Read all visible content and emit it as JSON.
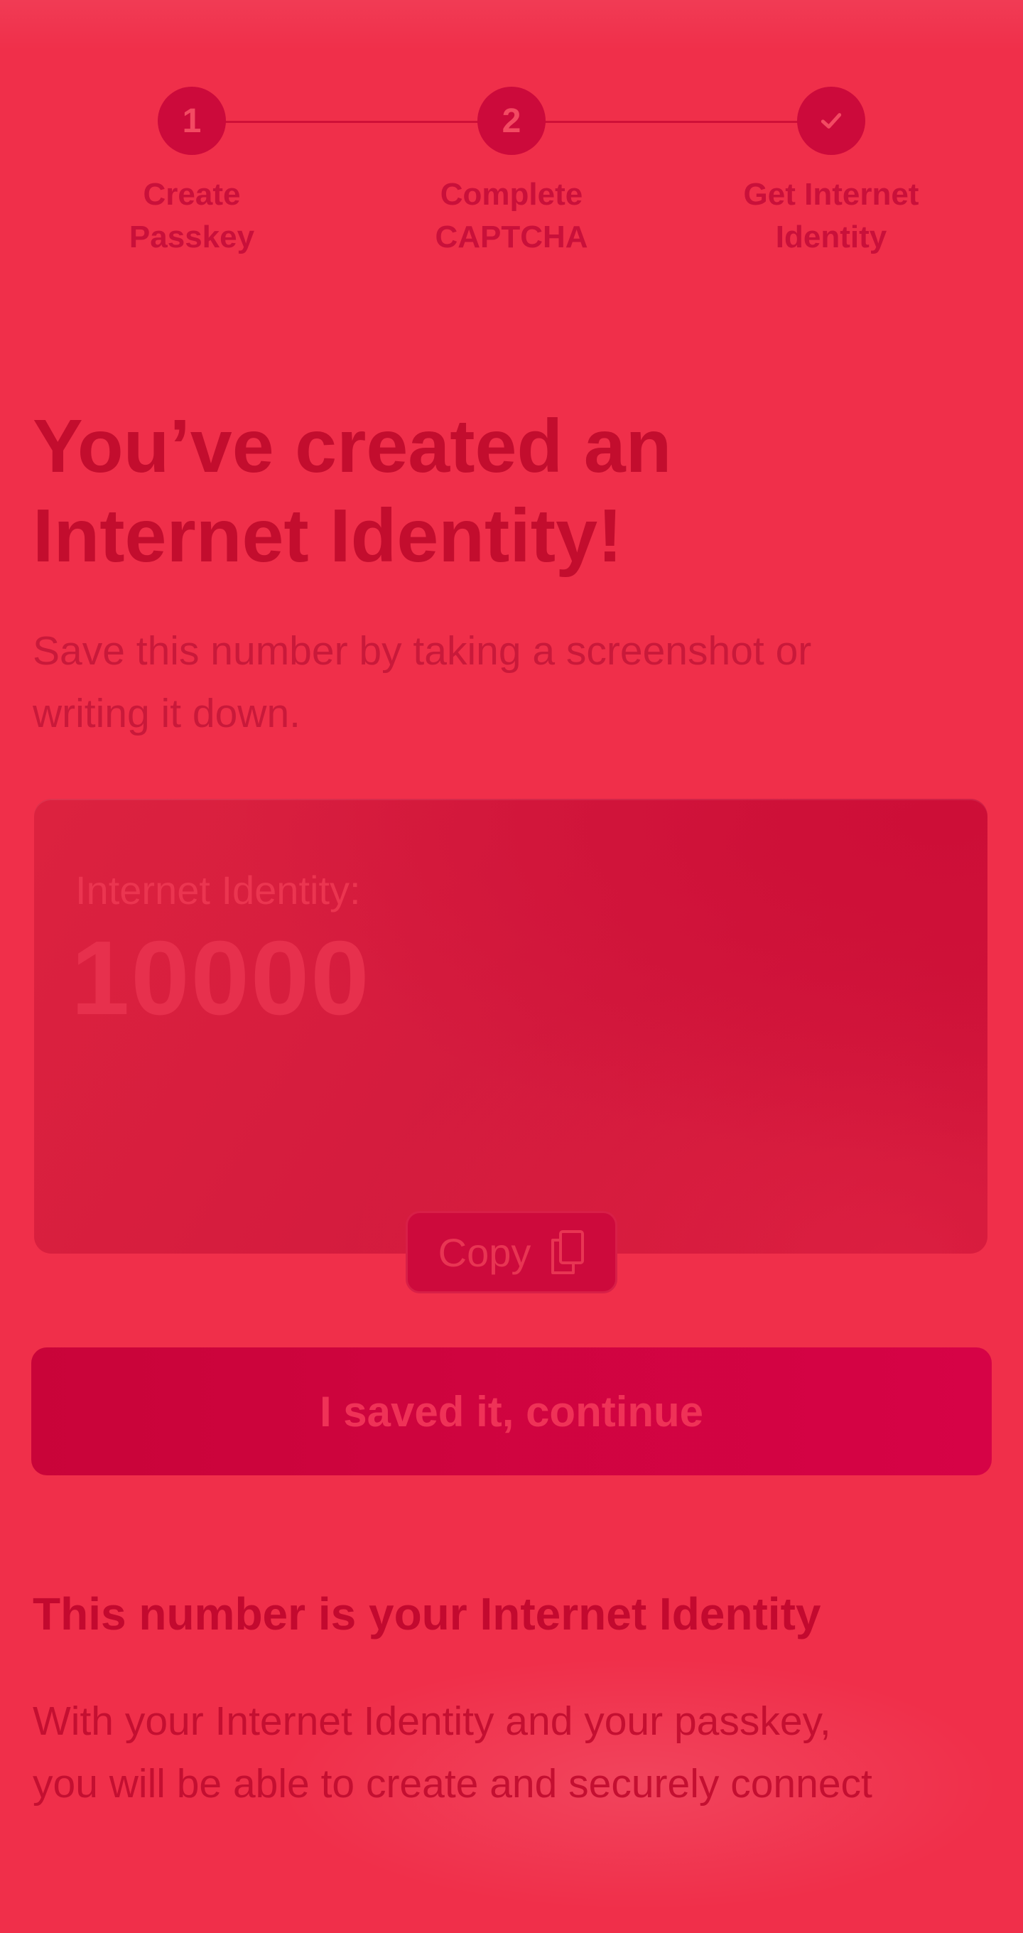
{
  "stepper": {
    "steps": [
      {
        "marker": "1",
        "label_line1": "Create",
        "label_line2": "Passkey"
      },
      {
        "marker": "2",
        "label_line1": "Complete",
        "label_line2": "CAPTCHA"
      },
      {
        "marker": "check-icon",
        "label_line1": "Get Internet",
        "label_line2": "Identity"
      }
    ]
  },
  "main": {
    "title_line1": "You’ve created an",
    "title_line2": "Internet Identity!",
    "subtitle_line1": "Save this number by taking a screenshot or",
    "subtitle_line2": "writing it down."
  },
  "identity_card": {
    "label": "Internet Identity:",
    "number": "10000",
    "copy_label": "Copy",
    "copy_icon": "copy-icon"
  },
  "primary_button": {
    "label": "I saved it, continue"
  },
  "info": {
    "title": "This number is your Internet Identity",
    "text_line1": "With your Internet Identity and your passkey,",
    "text_line2": "you will be able to create and securely connect"
  },
  "colors": {
    "background": "#f02f4a",
    "accent": "#cc0a3b",
    "text": "#c30d2e"
  }
}
